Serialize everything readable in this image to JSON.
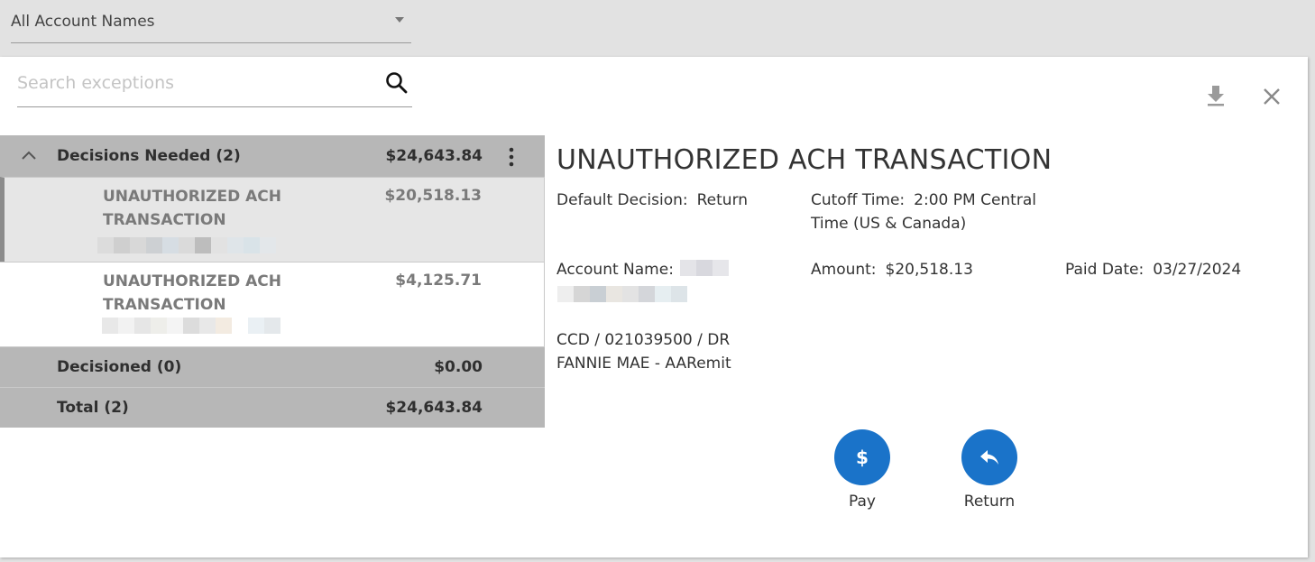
{
  "account_filter": {
    "selected": "All Account Names"
  },
  "search": {
    "placeholder": "Search exceptions",
    "value": ""
  },
  "list": {
    "decisions_needed": {
      "title": "Decisions Needed (2)",
      "amount": "$24,643.84"
    },
    "items": [
      {
        "title": "UNAUTHORIZED ACH TRANSACTION",
        "amount": "$20,518.13",
        "selected": true
      },
      {
        "title": "UNAUTHORIZED ACH TRANSACTION",
        "amount": "$4,125.71",
        "selected": false
      }
    ],
    "decisioned": {
      "title": "Decisioned (0)",
      "amount": "$0.00"
    },
    "total": {
      "title": "Total (2)",
      "amount": "$24,643.84"
    }
  },
  "detail": {
    "title": "UNAUTHORIZED ACH TRANSACTION",
    "default_decision_label": "Default Decision:",
    "default_decision_value": "Return",
    "cutoff_label": "Cutoff Time:",
    "cutoff_value": "2:00 PM Central Time (US & Canada)",
    "account_name_label": "Account Name:",
    "amount_label": "Amount:",
    "amount_value": "$20,518.13",
    "paid_date_label": "Paid Date:",
    "paid_date_value": "03/27/2024",
    "memo_line1": "CCD / 021039500 / DR",
    "memo_line2": "FANNIE MAE - AARemit"
  },
  "actions": {
    "pay_label": "Pay",
    "return_label": "Return"
  },
  "icons": {
    "search": "search-icon",
    "download": "download-icon",
    "close": "close-icon",
    "collapse": "chevron-up-icon",
    "more": "kebab-menu-icon",
    "pay": "dollar-icon",
    "return": "reply-arrow-icon"
  },
  "colors": {
    "accent": "#1a73c9",
    "group_header": "#b7b7b7",
    "selected_row": "#e6e6e6"
  }
}
